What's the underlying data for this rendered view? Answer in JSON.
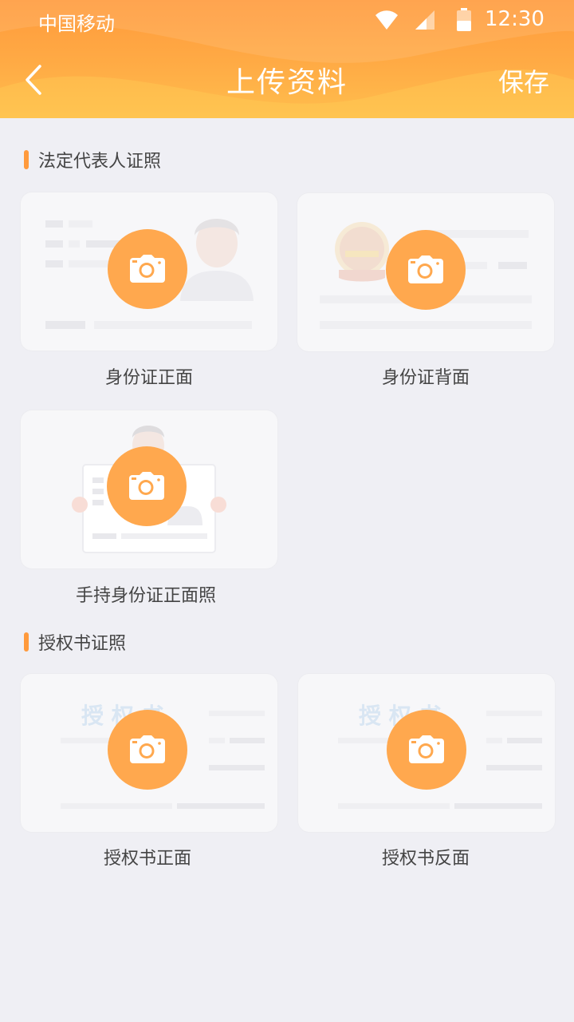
{
  "status_bar": {
    "carrier": "中国移动",
    "time": "12:30"
  },
  "header": {
    "title": "上传资料",
    "save_label": "保存",
    "back_icon": "chevron-left-icon"
  },
  "sections": [
    {
      "title": "法定代表人证照",
      "cards": [
        {
          "label": "身份证正面",
          "icon": "camera-icon"
        },
        {
          "label": "身份证背面",
          "icon": "camera-icon"
        },
        {
          "label": "手持身份证正面照",
          "icon": "camera-icon"
        }
      ]
    },
    {
      "title": "授权书证照",
      "cards": [
        {
          "label": "授权书正面",
          "icon": "camera-icon",
          "watermark": "授 权 书"
        },
        {
          "label": "授权书反面",
          "icon": "camera-icon",
          "watermark": "授 权 书"
        }
      ]
    }
  ],
  "colors": {
    "accent": "#ff9a3c",
    "camera": "#ffa84e",
    "background": "#efeff4"
  }
}
